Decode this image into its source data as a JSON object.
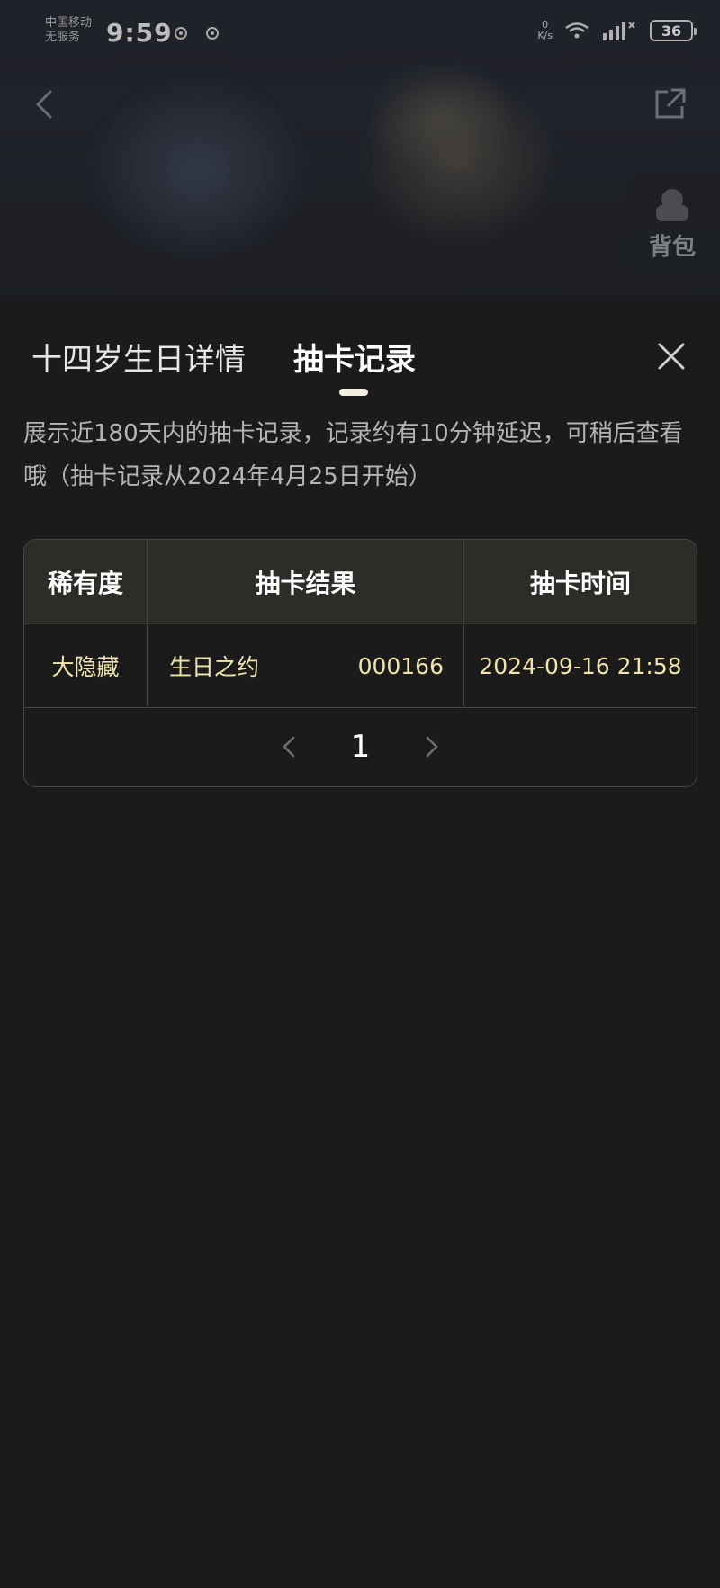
{
  "status_bar": {
    "carrier_line1": "中国移动",
    "carrier_line2": "无服务",
    "time": "9:59",
    "net_speed_value": "0",
    "net_speed_unit": "K/s",
    "battery": "36"
  },
  "hero": {
    "bag_label": "背包"
  },
  "tabs": [
    {
      "label": "十四岁生日详情"
    },
    {
      "label": "抽卡记录"
    }
  ],
  "notice": "展示近180天内的抽卡记录，记录约有10分钟延迟，可稍后查看哦（抽卡记录从2024年4月25日开始）",
  "table": {
    "headers": [
      "稀有度",
      "抽卡结果",
      "抽卡时间"
    ],
    "rows": [
      {
        "rarity": "大隐藏",
        "result_name": "生日之约",
        "result_no": "000166",
        "time": "2024-09-16 21:58"
      }
    ]
  },
  "pager": {
    "page": "1"
  },
  "colors": {
    "background": "#1b1b1b",
    "accent_gold": "#f1e4ad",
    "header_bg": "#2e2c28",
    "border": "#4a463e"
  },
  "icons": [
    "back-icon",
    "share-icon",
    "bag-icon",
    "close-icon",
    "chevron-left-icon",
    "chevron-right-icon",
    "wifi-icon",
    "signal-icon"
  ]
}
